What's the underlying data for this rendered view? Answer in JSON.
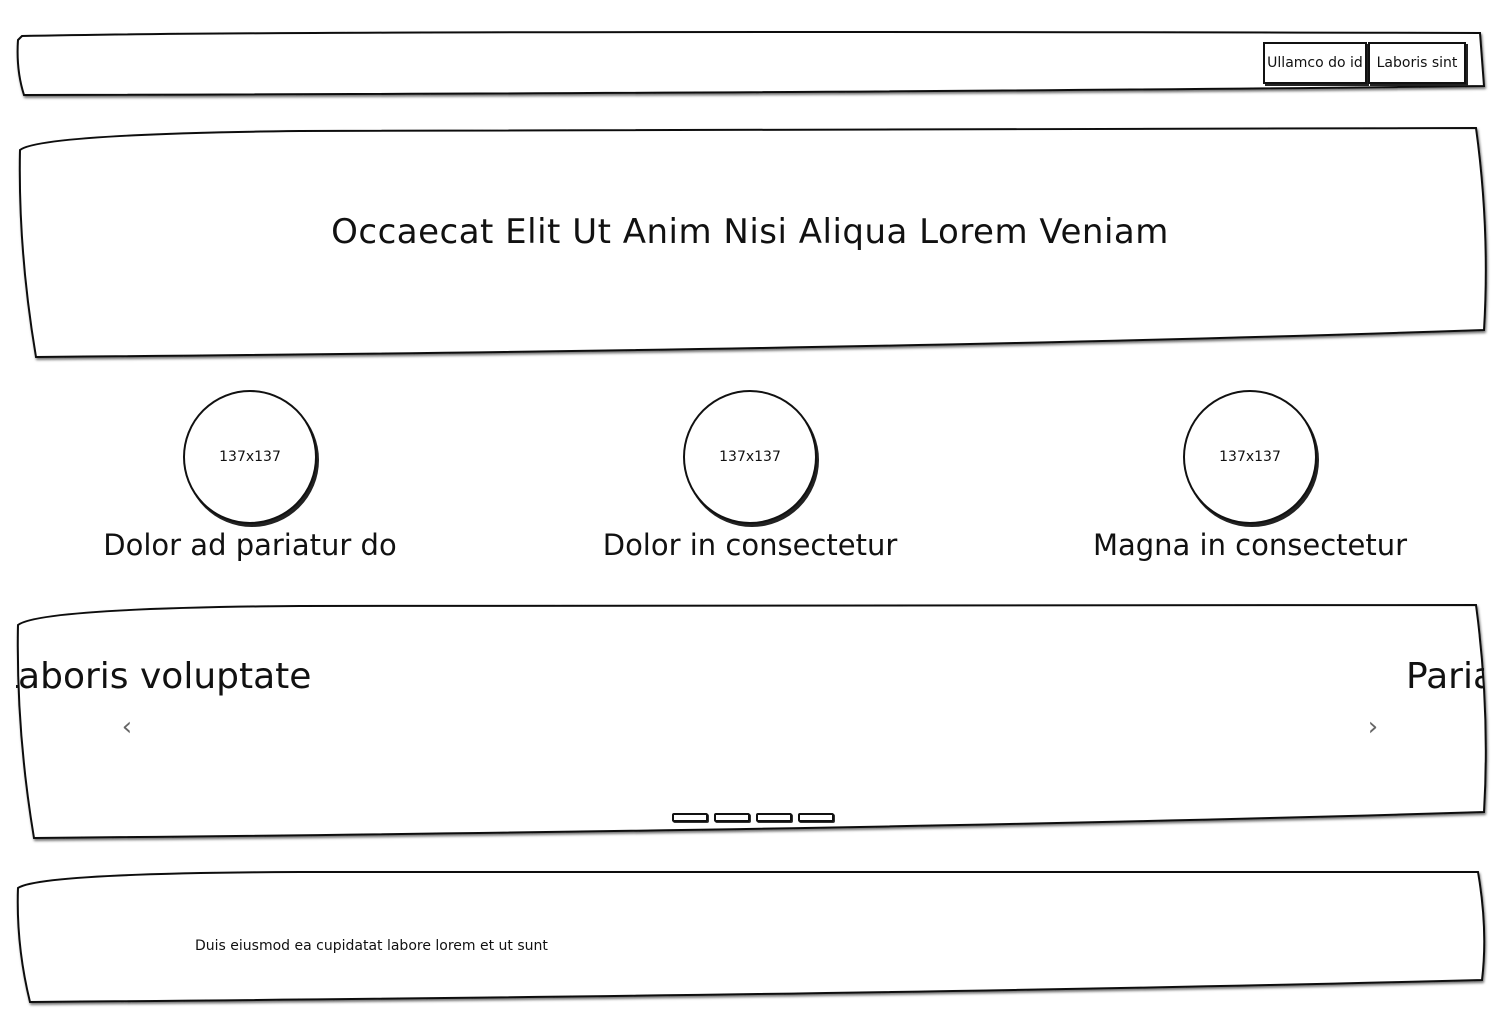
{
  "header": {
    "nav": [
      {
        "label": "Ullamco do id"
      },
      {
        "label": "Laboris sint"
      }
    ]
  },
  "hero": {
    "title": "Occaecat Elit Ut Anim Nisi Aliqua Lorem Veniam"
  },
  "features": [
    {
      "image_label": "137x137",
      "caption": "Dolor ad pariatur do"
    },
    {
      "image_label": "137x137",
      "caption": "Dolor in consectetur"
    },
    {
      "image_label": "137x137",
      "caption": "Magna in consectetur"
    }
  ],
  "carousel": {
    "prev_slide_text": "Laboris voluptate",
    "next_slide_text": "Pariatur",
    "prev_icon": "chevron-left-icon",
    "next_icon": "chevron-right-icon",
    "prev_glyph": "‹",
    "next_glyph": "›",
    "indicator_count": 4
  },
  "footer": {
    "text": "Duis eiusmod ea cupidatat labore lorem et ut sunt"
  }
}
